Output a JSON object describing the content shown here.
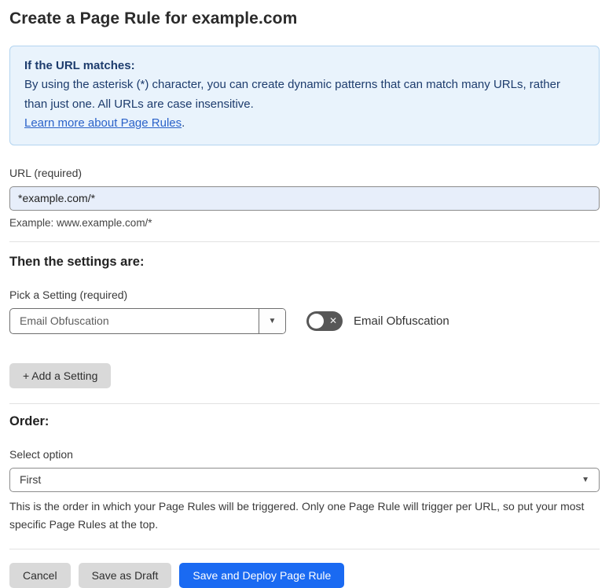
{
  "page": {
    "title": "Create a Page Rule for example.com"
  },
  "info_box": {
    "heading": "If the URL matches:",
    "body": "By using the asterisk (*) character, you can create dynamic patterns that can match many URLs, rather than just one. All URLs are case insensitive.",
    "link_label": "Learn more about Page Rules",
    "link_suffix": "."
  },
  "url_field": {
    "label": "URL (required)",
    "value": "*example.com/*",
    "helper": "Example: www.example.com/*"
  },
  "settings_section": {
    "heading": "Then the settings are:",
    "picker_label": "Pick a Setting (required)",
    "picker_value": "Email Obfuscation",
    "toggle_label": "Email Obfuscation",
    "toggle_state": "off",
    "add_button_label": "+ Add a Setting"
  },
  "order_section": {
    "heading": "Order:",
    "select_label": "Select option",
    "select_value": "First",
    "helper": "This is the order in which your Page Rules will be triggered. Only one Page Rule will trigger per URL, so put your most specific Page Rules at the top."
  },
  "footer": {
    "cancel_label": "Cancel",
    "save_draft_label": "Save as Draft",
    "save_deploy_label": "Save and Deploy Page Rule"
  },
  "icons": {
    "dropdown_arrow": "▼",
    "toggle_off_x": "✕"
  },
  "colors": {
    "info_bg": "#e9f3fc",
    "info_border": "#b3d4f0",
    "info_text": "#1d3c6d",
    "link": "#2a62c9",
    "input_bg": "#e7eefa",
    "primary_button": "#1a6af2",
    "gray_button": "#d9d9d9",
    "toggle_off": "#575757"
  }
}
